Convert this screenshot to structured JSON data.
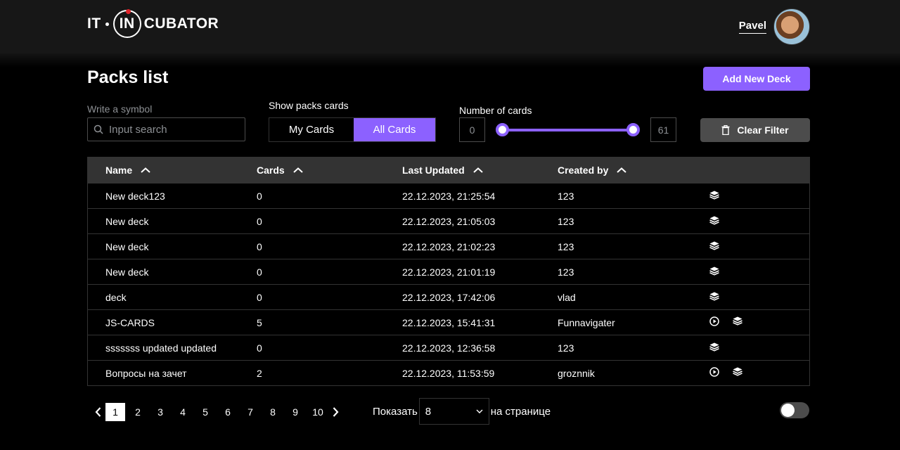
{
  "header": {
    "logo_left": "IT",
    "logo_mid": "IN",
    "logo_right": "CUBATOR",
    "user_name": "Pavel"
  },
  "page": {
    "title": "Packs list",
    "add_button": "Add New Deck"
  },
  "filters": {
    "search_label": "Write a symbol",
    "search_placeholder": "Input search",
    "show_label": "Show packs cards",
    "tabs": [
      "My Cards",
      "All Cards"
    ],
    "active_tab": "All Cards",
    "number_label": "Number of cards",
    "min": "0",
    "max": "61",
    "clear_button": "Clear Filter"
  },
  "table": {
    "columns": [
      "Name",
      "Cards",
      "Last Updated",
      "Created by"
    ],
    "rows": [
      {
        "name": "New deck123",
        "cards": "0",
        "updated": "22.12.2023, 21:25:54",
        "author": "123",
        "play": false
      },
      {
        "name": "New deck",
        "cards": "0",
        "updated": "22.12.2023, 21:05:03",
        "author": "123",
        "play": false
      },
      {
        "name": "New deck",
        "cards": "0",
        "updated": "22.12.2023, 21:02:23",
        "author": "123",
        "play": false
      },
      {
        "name": "New deck",
        "cards": "0",
        "updated": "22.12.2023, 21:01:19",
        "author": "123",
        "play": false
      },
      {
        "name": "deck",
        "cards": "0",
        "updated": "22.12.2023, 17:42:06",
        "author": "vlad",
        "play": false
      },
      {
        "name": "JS-CARDS",
        "cards": "5",
        "updated": "22.12.2023, 15:41:31",
        "author": "Funnavigater",
        "play": true
      },
      {
        "name": "sssssss updated updated",
        "cards": "0",
        "updated": "22.12.2023, 12:36:58",
        "author": "123",
        "play": false
      },
      {
        "name": "Вопросы на зачет",
        "cards": "2",
        "updated": "22.12.2023, 11:53:59",
        "author": "groznnik",
        "play": true
      }
    ]
  },
  "pagination": {
    "pages": [
      "1",
      "2",
      "3",
      "4",
      "5",
      "6",
      "7",
      "8",
      "9",
      "10"
    ],
    "current": "1",
    "show_label": "Показать",
    "per_page": "8",
    "per_page_suffix": "на странице"
  },
  "colors": {
    "accent": "#8c61ff",
    "background": "#000000",
    "header": "#171717",
    "border": "#333333"
  }
}
